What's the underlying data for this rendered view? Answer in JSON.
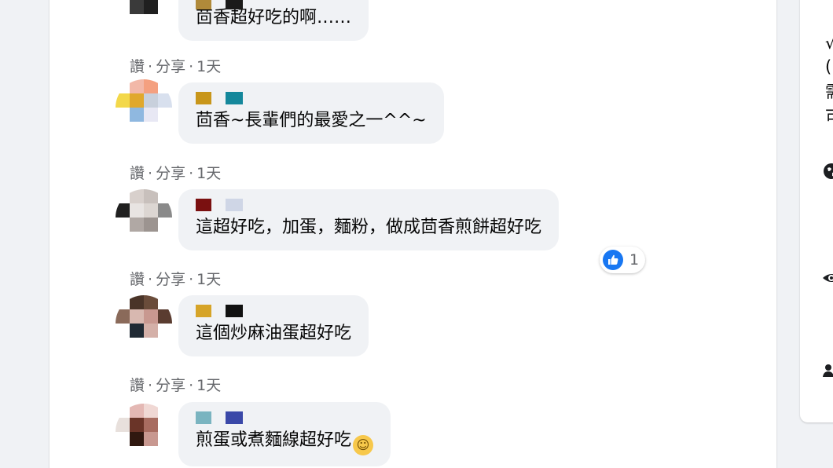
{
  "comments": [
    {
      "text": "茴香超好吃的啊……",
      "actions": {
        "like": "讚",
        "sep1": "·",
        "share": "分享",
        "sep2": "·",
        "time": "1天"
      },
      "avatar_colors": [
        "#ffffff",
        "#e8e8e8",
        "#5a5a5a",
        "#e0e0e0",
        "#ffffff",
        "#2d2d2d",
        "#1a1a1a",
        "#6a6a6a",
        "#ffffff",
        "#3a3a3a",
        "#202020",
        "#ffffff",
        "#ffffff",
        "#ffffff",
        "#ffffff",
        "#ffffff"
      ],
      "name_colors": [
        "#b08a3a",
        "#1a1a1a"
      ]
    },
    {
      "text": "茴香~長輩們的最愛之一^^~",
      "actions": {
        "like": "讚",
        "sep1": "·",
        "share": "分享",
        "sep2": "·",
        "time": "1天"
      },
      "avatar_colors": [
        "#ffffff",
        "#f2b8a8",
        "#f4a080",
        "#ffffff",
        "#f3d84a",
        "#e0a82c",
        "#c8d0dc",
        "#d8e0ee",
        "#ffffff",
        "#8fb8e0",
        "#e8e8f4",
        "#ffffff",
        "#ffffff",
        "#ffffff",
        "#ffffff",
        "#ffffff"
      ],
      "name_colors": [
        "#c8961a",
        "#14879b"
      ]
    },
    {
      "text": "這超好吃，加蛋，麵粉，做成茴香煎餅超好吃",
      "actions": {
        "like": "讚",
        "sep1": "·",
        "share": "分享",
        "sep2": "·",
        "time": "1天"
      },
      "reaction_count": "1",
      "avatar_colors": [
        "#ffffff",
        "#d8d0cc",
        "#c8c0bc",
        "#ffffff",
        "#202020",
        "#e8e4e2",
        "#dcd6d2",
        "#8a8a8a",
        "#ffffff",
        "#b0a8a4",
        "#9c9490",
        "#ffffff",
        "#ffffff",
        "#ffffff",
        "#ffffff",
        "#ffffff"
      ],
      "name_colors": [
        "#7a1010",
        "#cfd6e6"
      ]
    },
    {
      "text": "這個炒麻油蛋超好吃",
      "actions": {
        "like": "讚",
        "sep1": "·",
        "share": "分享",
        "sep2": "·",
        "time": "1天"
      },
      "avatar_colors": [
        "#ffffff",
        "#4a3428",
        "#6a4c3a",
        "#ffffff",
        "#8a6a5a",
        "#d8b8b0",
        "#c89890",
        "#5a3c30",
        "#ffffff",
        "#202a34",
        "#d4b0a8",
        "#ffffff",
        "#ffffff",
        "#ffffff",
        "#ffffff",
        "#ffffff"
      ],
      "name_colors": [
        "#d6a428",
        "#111111"
      ]
    },
    {
      "text": "煎蛋或煮麵線超好吃",
      "emoji": "☺",
      "avatar_colors": [
        "#ffffff",
        "#e4b8b4",
        "#f0d8d4",
        "#ffffff",
        "#e8e0dc",
        "#6a3428",
        "#a86c60",
        "#ffffff",
        "#ffffff",
        "#301810",
        "#c89890",
        "#ffffff",
        "#ffffff",
        "#ffffff",
        "#ffffff",
        "#ffffff"
      ],
      "name_colors": [
        "#7ab4c0",
        "#3a48a8"
      ]
    }
  ],
  "side_panel": {
    "lines": [
      "√",
      "(",
      "需",
      "可"
    ],
    "icons": [
      "globe-icon",
      "eye-icon",
      "members-icon"
    ]
  }
}
